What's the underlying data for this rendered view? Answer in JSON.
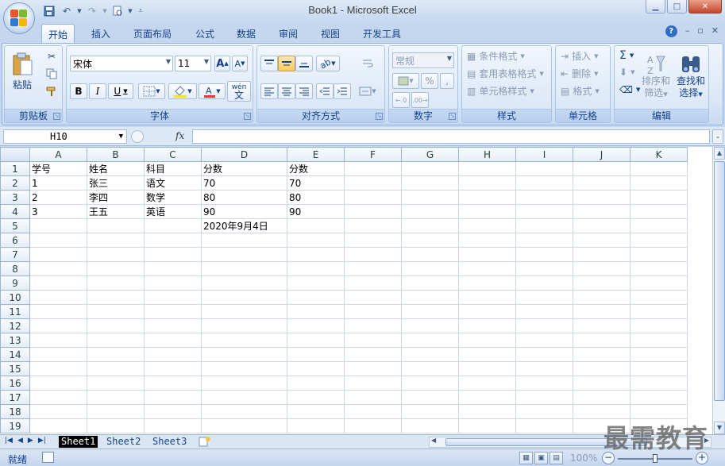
{
  "window": {
    "title": "Book1 - Microsoft Excel",
    "min_label": "▁",
    "max_label": "□",
    "close_label": "✕"
  },
  "qat": [
    "save-icon",
    "undo-icon",
    "redo-icon",
    "print-preview-icon",
    "customize-icon"
  ],
  "tabs": [
    "开始",
    "插入",
    "页面布局",
    "公式",
    "数据",
    "审阅",
    "视图",
    "开发工具"
  ],
  "active_tab": "开始",
  "help": {
    "icon": "?",
    "min": "–",
    "restore": "▫",
    "close": "✕"
  },
  "ribbon": {
    "clipboard": {
      "label": "剪贴板",
      "paste": "粘贴"
    },
    "font": {
      "label": "字体",
      "font_name": "宋体",
      "font_size": "11",
      "grow": "A",
      "shrink": "A",
      "bold": "B",
      "italic": "I",
      "underline": "U",
      "wen": "wén",
      "wen_char": "文"
    },
    "alignment": {
      "label": "对齐方式"
    },
    "number": {
      "label": "数字",
      "format": "常规",
      "percent": "%",
      "comma": ","
    },
    "styles": {
      "label": "样式",
      "conditional": "条件格式",
      "table": "套用表格格式",
      "cell": "单元格样式"
    },
    "cells": {
      "label": "单元格",
      "insert": "插入",
      "delete": "删除",
      "format": "格式"
    },
    "editing": {
      "label": "编辑",
      "sigma": "Σ",
      "sort1": "排序和",
      "sort2": "筛选",
      "find1": "查找和",
      "find2": "选择"
    }
  },
  "formula_bar": {
    "name_box": "H10",
    "fx": "fx",
    "content": ""
  },
  "sheet": {
    "columns": [
      "A",
      "B",
      "C",
      "D",
      "E",
      "F",
      "G",
      "H",
      "I",
      "J",
      "K"
    ],
    "rows": [
      [
        "学号",
        "姓名",
        "科目",
        "分数",
        "分数",
        "",
        "",
        "",
        "",
        "",
        ""
      ],
      [
        "1",
        "张三",
        "语文",
        "70",
        "70",
        "",
        "",
        "",
        "",
        "",
        ""
      ],
      [
        "2",
        "李四",
        "数学",
        "80",
        "80",
        "",
        "",
        "",
        "",
        "",
        ""
      ],
      [
        "3",
        "王五",
        "英语",
        "90",
        "90",
        "",
        "",
        "",
        "",
        "",
        ""
      ],
      [
        "",
        "",
        "",
        "2020年9月4日",
        "",
        "",
        "",
        "",
        "",
        "",
        ""
      ],
      [
        "",
        "",
        "",
        "",
        "",
        "",
        "",
        "",
        "",
        "",
        ""
      ],
      [
        "",
        "",
        "",
        "",
        "",
        "",
        "",
        "",
        "",
        "",
        ""
      ],
      [
        "",
        "",
        "",
        "",
        "",
        "",
        "",
        "",
        "",
        "",
        ""
      ],
      [
        "",
        "",
        "",
        "",
        "",
        "",
        "",
        "",
        "",
        "",
        ""
      ],
      [
        "",
        "",
        "",
        "",
        "",
        "",
        "",
        "",
        "",
        "",
        ""
      ],
      [
        "",
        "",
        "",
        "",
        "",
        "",
        "",
        "",
        "",
        "",
        ""
      ],
      [
        "",
        "",
        "",
        "",
        "",
        "",
        "",
        "",
        "",
        "",
        ""
      ],
      [
        "",
        "",
        "",
        "",
        "",
        "",
        "",
        "",
        "",
        "",
        ""
      ],
      [
        "",
        "",
        "",
        "",
        "",
        "",
        "",
        "",
        "",
        "",
        ""
      ],
      [
        "",
        "",
        "",
        "",
        "",
        "",
        "",
        "",
        "",
        "",
        ""
      ],
      [
        "",
        "",
        "",
        "",
        "",
        "",
        "",
        "",
        "",
        "",
        ""
      ],
      [
        "",
        "",
        "",
        "",
        "",
        "",
        "",
        "",
        "",
        "",
        ""
      ],
      [
        "",
        "",
        "",
        "",
        "",
        "",
        "",
        "",
        "",
        "",
        ""
      ],
      [
        "",
        "",
        "",
        "",
        "",
        "",
        "",
        "",
        "",
        "",
        ""
      ]
    ]
  },
  "sheet_tabs": [
    "Sheet1",
    "Sheet2",
    "Sheet3"
  ],
  "active_sheet": "Sheet1",
  "status": {
    "ready": "就绪",
    "zoom": "100%",
    "zoom_minus": "−",
    "zoom_plus": "+"
  },
  "watermark": "最需教育",
  "colors": {
    "accent": "#15428b",
    "ribbon_bg": "#dbe7f6",
    "grid_line": "#d0d7e5"
  }
}
